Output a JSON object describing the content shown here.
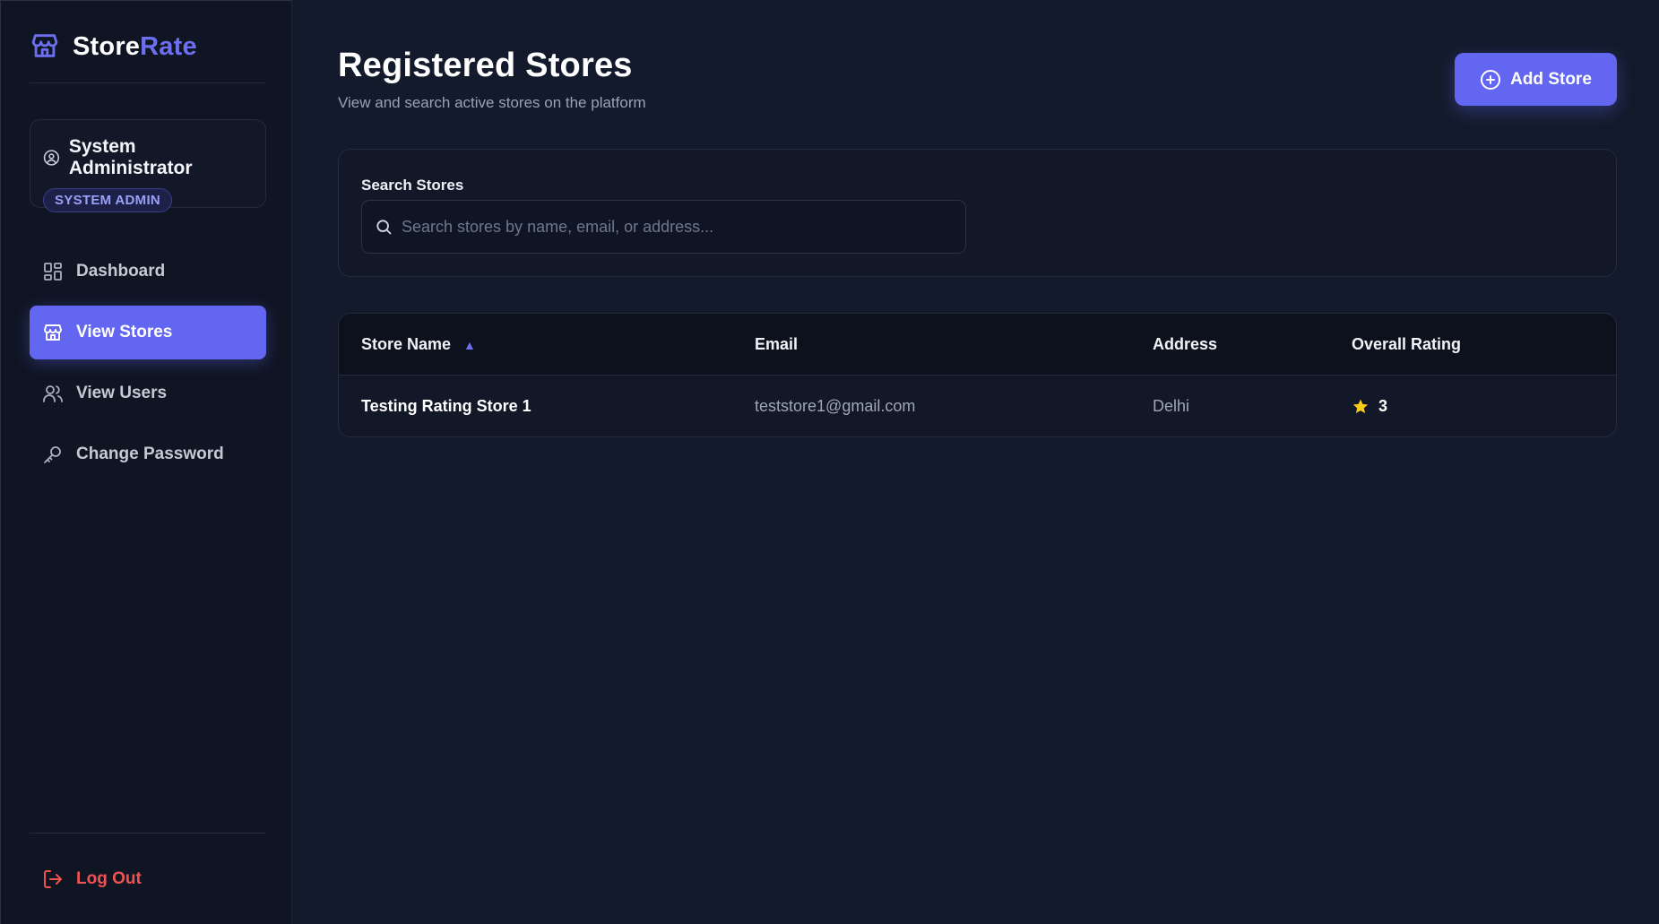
{
  "brand": {
    "part1": "Store",
    "part2": "Rate"
  },
  "user": {
    "name": "System Administrator",
    "role": "SYSTEM ADMIN"
  },
  "nav": [
    {
      "label": "Dashboard",
      "icon": "dashboard-icon",
      "active": false
    },
    {
      "label": "View Stores",
      "icon": "store-icon",
      "active": true
    },
    {
      "label": "View Users",
      "icon": "users-icon",
      "active": false
    },
    {
      "label": "Change Password",
      "icon": "key-icon",
      "active": false
    }
  ],
  "logout": {
    "label": "Log Out",
    "icon": "logout-icon"
  },
  "page": {
    "title": "Registered Stores",
    "subtitle": "View and search active stores on the platform",
    "add_button": "Add Store"
  },
  "search": {
    "label": "Search Stores",
    "placeholder": "Search stores by name, email, or address..."
  },
  "table": {
    "columns": [
      "Store Name",
      "Email",
      "Address",
      "Overall Rating"
    ],
    "sort_indicator": "▲",
    "rows": [
      {
        "name": "Testing Rating Store 1",
        "email": "teststore1@gmail.com",
        "address": "Delhi",
        "rating": "3"
      }
    ]
  },
  "colors": {
    "accent": "#6366f1",
    "danger": "#f05252",
    "star": "#facc15",
    "background": "#131a2b",
    "sidebar": "#0f1523"
  }
}
